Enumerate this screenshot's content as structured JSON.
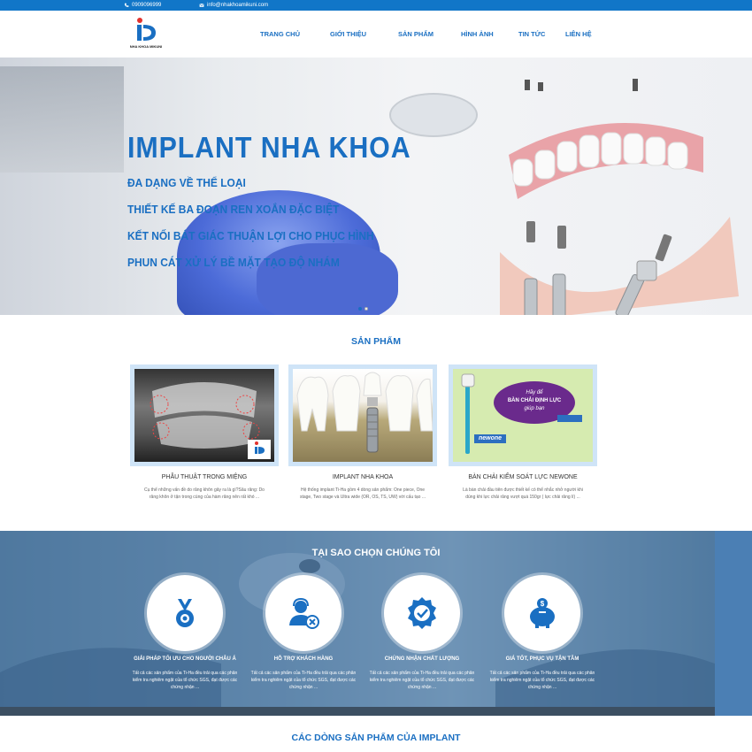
{
  "topbar": {
    "phone": "0909096999",
    "email": "info@nhakhoamikuni.com"
  },
  "logo": {
    "text": "NHA KHOA MIKUNI"
  },
  "nav": {
    "items": [
      {
        "label": "TRANG CHỦ"
      },
      {
        "label": "GIỚI THIỆU"
      },
      {
        "label": "SẢN PHẨM"
      },
      {
        "label": "HÌNH ẢNH"
      },
      {
        "label": "TIN TỨC"
      },
      {
        "label": "LIÊN HỆ"
      }
    ]
  },
  "hero": {
    "title": "IMPLANT NHA KHOA",
    "lines": [
      "ĐA DẠNG VỀ THỂ LOẠI",
      "THIẾT KẾ BA ĐOẠN REN XOẮN ĐẶC BIỆT",
      "KẾT NỐI BÁT GIÁC THUẬN LỢI CHO PHỤC HÌNH",
      "PHUN CÁT XỬ LÝ BỀ MẶT TẠO ĐỘ NHÁM"
    ]
  },
  "products": {
    "title": "SẢN PHẨM",
    "items": [
      {
        "name": "PHẪU THUẬT TRONG MIỆNG",
        "desc": "Cụ thể những vấn đề do răng khôn gây ra là gì?Sâu răng: Do răng khôn ở tận trong cùng của hàm răng nên rất khó ..."
      },
      {
        "name": "IMPLANT NHA KHOA",
        "desc": "Hệ thống implant Ti-Ha gồm 4 dòng sản phẩm: One piece, One stage, Two stage và Ultra wide (OR, OS, TS, UW) với cấu tạo ..."
      },
      {
        "name": "BÀN CHẢI KIỂM SOÁT LỰC NEWONE",
        "desc": "Là bàn chải đầu tiên được thiết kế có thể nhắc nhở người khi dùng khi lực chải răng vượt quá 150gr ( lực chải răng lí) ..."
      }
    ],
    "brush_banner": {
      "line1": "Hãy để",
      "line2": "BÀN CHẢI ĐỊNH LỰC",
      "line3": "giúp bạn",
      "brand": "newone"
    }
  },
  "why": {
    "title": "TẠI SAO CHỌN CHÚNG TÔI",
    "features": [
      {
        "label": "GIẢI PHÁP TỐI ƯU CHO NGƯỜI CHÂU Á",
        "text": "Tất cả các sản phẩm của Ti-Ha đều trải qua các phân kiểm tra nghiêm ngặt của tổ chức SGS, đạt được các chứng nhận ..."
      },
      {
        "label": "HỖ TRỢ KHÁCH HÀNG",
        "text": "Tất cả các sản phẩm của Ti-Ha đều trải qua các phân kiểm tra nghiêm ngặt của tổ chức SGS, đạt được các chứng nhận ..."
      },
      {
        "label": "CHỨNG NHẬN CHẤT LƯỢNG",
        "text": "Tất cả các sản phẩm của Ti-Ha đều trải qua các phân kiểm tra nghiêm ngặt của tổ chức SGS, đạt được các chứng nhận ..."
      },
      {
        "label": "GIÁ TỐT, PHỤC VỤ TẬN TÂM",
        "text": "Tất cả các sản phẩm của Ti-Ha đều trải qua các phân kiểm tra nghiêm ngặt của tổ chức SGS, đạt được các chứng nhận ..."
      }
    ]
  },
  "bottom": {
    "title": "CÁC DÒNG SẢN PHẨM CỦA IMPLANT"
  },
  "colors": {
    "brand": "#1a6fc2",
    "topbar": "#1176c8"
  }
}
